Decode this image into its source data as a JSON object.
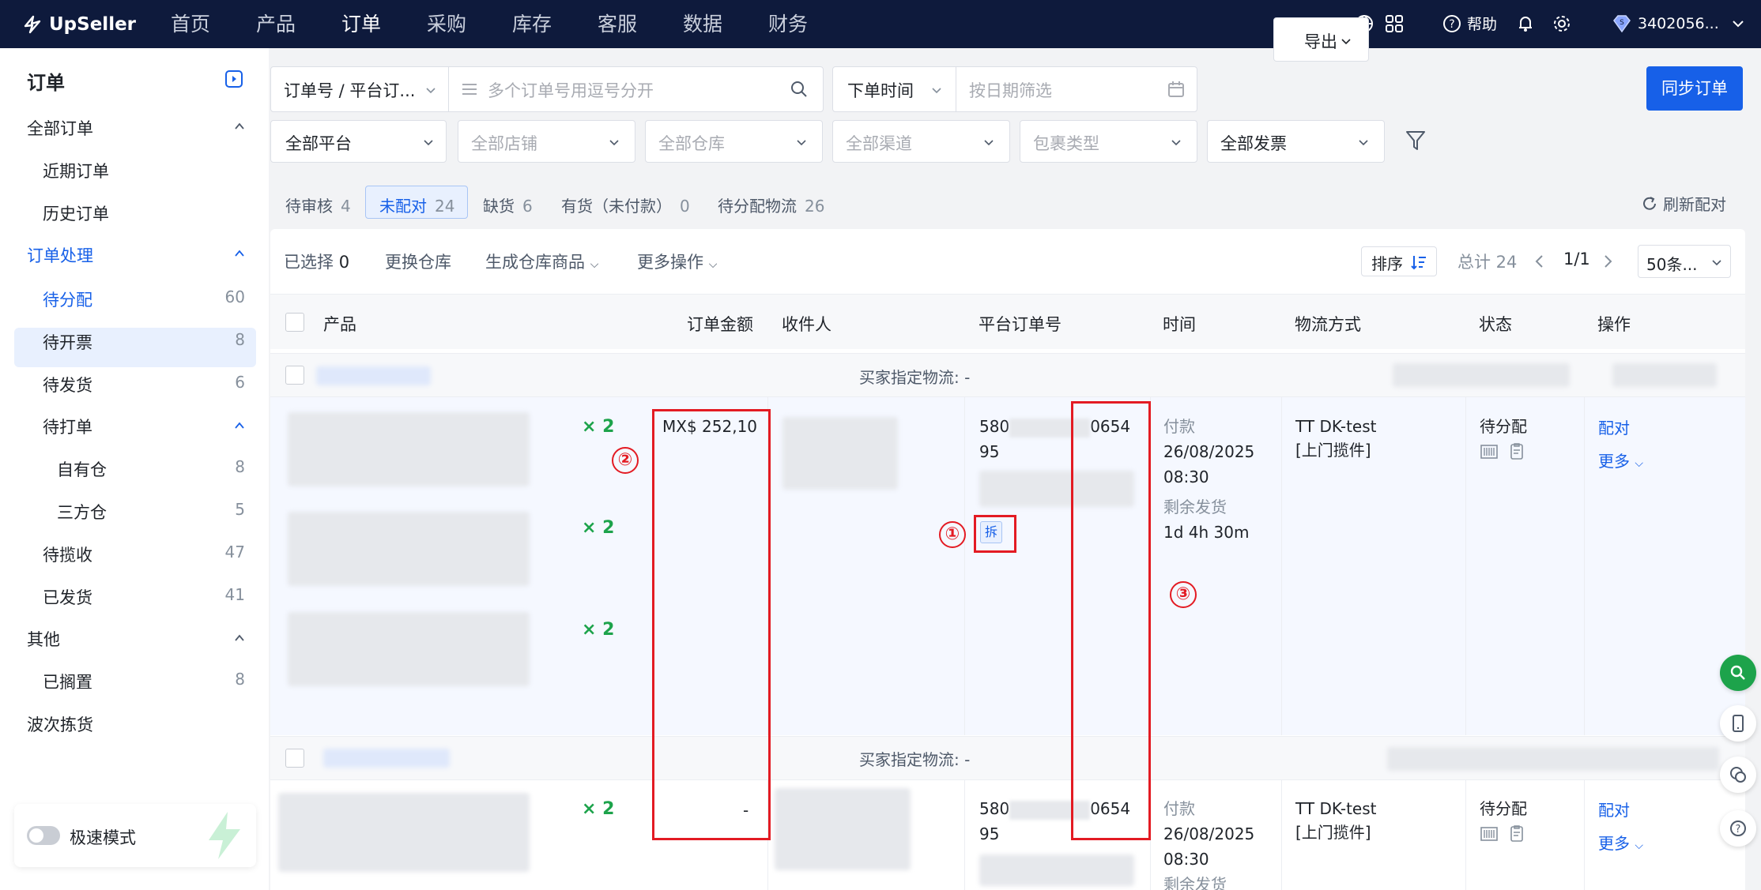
{
  "topbar": {
    "brand": "UpSeller",
    "nav": [
      "首页",
      "产品",
      "订单",
      "采购",
      "库存",
      "客服",
      "数据",
      "财务"
    ],
    "active_nav": "订单",
    "help_label": "帮助",
    "account_label": "3402056..."
  },
  "sidebar": {
    "title": "订单",
    "all_orders": "全部订单",
    "recent_orders": "近期订单",
    "history_orders": "历史订单",
    "order_processing": "订单处理",
    "items": [
      {
        "label": "待分配",
        "count": "60"
      },
      {
        "label": "待开票",
        "count": "8"
      },
      {
        "label": "待发货",
        "count": "6"
      },
      {
        "label": "待打单",
        "count": ""
      },
      {
        "label": "自有仓",
        "count": "8"
      },
      {
        "label": "三方仓",
        "count": "5"
      },
      {
        "label": "待揽收",
        "count": "47"
      },
      {
        "label": "已发货",
        "count": "41"
      }
    ],
    "others": "其他",
    "shelved": {
      "label": "已搁置",
      "count": "8"
    },
    "wave_picking": "波次拣货",
    "speed_mode": "极速模式"
  },
  "filters": {
    "order_no_select": "订单号 / 平台订...",
    "search_placeholder": "多个订单号用逗号分开",
    "time_select": "下单时间",
    "date_placeholder": "按日期筛选",
    "export_label": "导出",
    "sync_label": "同步订单",
    "platform": "全部平台",
    "store": "全部店铺",
    "warehouse": "全部仓库",
    "channel": "全部渠道",
    "package_type": "包裹类型",
    "invoice": "全部发票"
  },
  "tabs": [
    {
      "label": "待审核",
      "count": "4"
    },
    {
      "label": "未配对",
      "count": "24"
    },
    {
      "label": "缺货",
      "count": "6"
    },
    {
      "label": "有货（未付款）",
      "count": "0"
    },
    {
      "label": "待分配物流",
      "count": "26"
    }
  ],
  "refresh_pairing": "刷新配对",
  "toolbar": {
    "selected_label": "已选择",
    "selected_count": "0",
    "change_warehouse": "更换仓库",
    "gen_warehouse_goods": "生成仓库商品",
    "more_actions": "更多操作",
    "sort": "排序",
    "total": "总计 24",
    "page": "1/1",
    "page_size": "50条..."
  },
  "table": {
    "headers": [
      "产品",
      "订单金额",
      "收件人",
      "平台订单号",
      "时间",
      "物流方式",
      "状态",
      "操作"
    ],
    "groups": [
      {
        "buyer_logistics": "买家指定物流: -",
        "qty": [
          "× 2",
          "× 2",
          "× 2"
        ],
        "amount": "MX$ 252,10",
        "order_no_prefix": "580",
        "order_no_suffix": "0654",
        "order_no_line2": "95",
        "split_tag": "拆",
        "paid_label": "付款",
        "date": "26/08/2025",
        "time": "08:30",
        "remaining_label": "剩余发货",
        "remaining": "1d 4h 30m",
        "logistics": "TT DK-test",
        "logistics_sub": "[上门揽件]",
        "status": "待分配",
        "action_pair": "配对",
        "action_more": "更多"
      },
      {
        "buyer_logistics": "买家指定物流: -",
        "qty": [
          "× 2"
        ],
        "amount": "-",
        "order_no_prefix": "580",
        "order_no_suffix": "0654",
        "order_no_line2": "95",
        "paid_label": "付款",
        "date": "26/08/2025",
        "time": "08:30",
        "remaining_label": "剩余发货",
        "logistics": "TT DK-test",
        "logistics_sub": "[上门揽件]",
        "status": "待分配",
        "action_pair": "配对",
        "action_more": "更多"
      }
    ]
  },
  "annotations": [
    "①",
    "②",
    "③"
  ],
  "colors": {
    "topbar": "#0e1a3c",
    "primary": "#1760e8",
    "qty_green": "#1da34b",
    "annotation_red": "#e31b23"
  }
}
